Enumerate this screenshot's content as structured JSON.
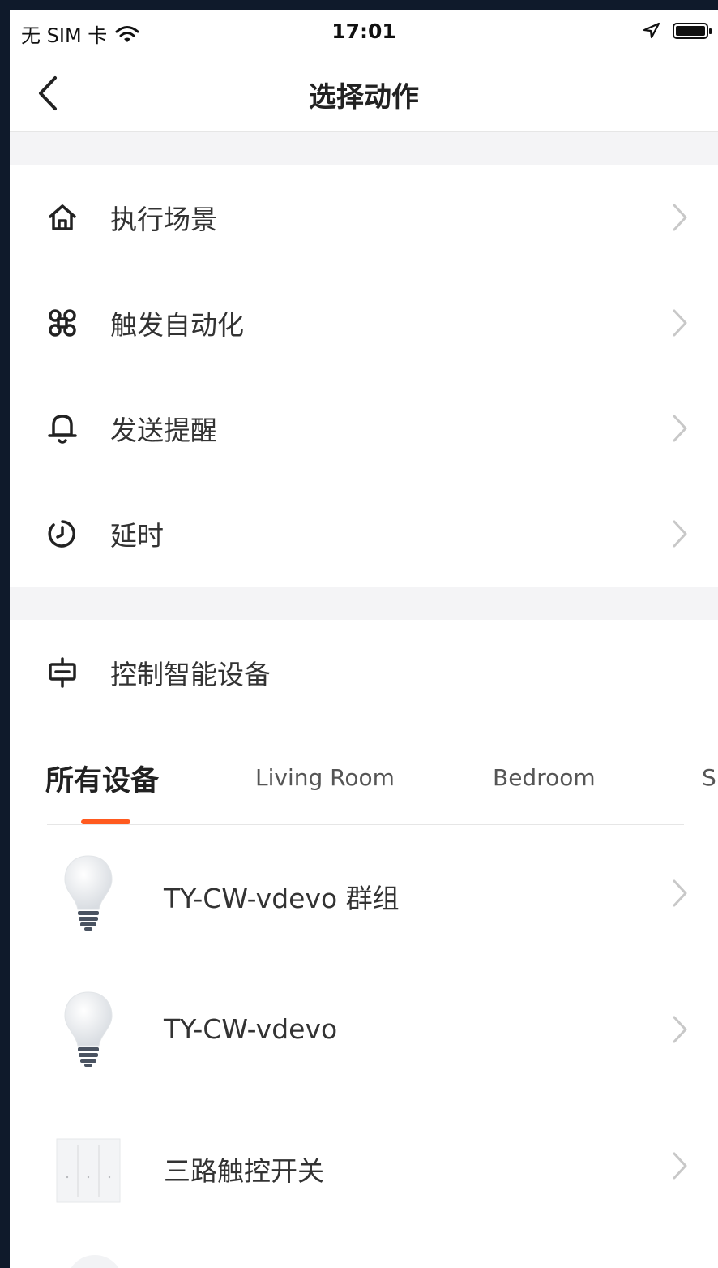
{
  "status_bar": {
    "carrier": "无 SIM 卡",
    "time": "17:01"
  },
  "header": {
    "title": "选择动作"
  },
  "actions": [
    {
      "label": "执行场景",
      "icon": "home-icon"
    },
    {
      "label": "触发自动化",
      "icon": "command-icon"
    },
    {
      "label": "发送提醒",
      "icon": "bell-icon"
    },
    {
      "label": "延时",
      "icon": "timer-icon"
    }
  ],
  "control_section": {
    "label": "控制智能设备",
    "icon": "device-control-icon"
  },
  "tabs": [
    {
      "label": "所有设备",
      "active": true
    },
    {
      "label": "Living Room"
    },
    {
      "label": "Bedroom"
    },
    {
      "label": "S"
    }
  ],
  "devices": [
    {
      "name": "TY-CW-vdevo 群组",
      "icon": "bulb-icon"
    },
    {
      "name": "TY-CW-vdevo",
      "icon": "bulb-icon"
    },
    {
      "name": "三路触控开关",
      "icon": "switch-panel-icon"
    }
  ],
  "colors": {
    "accent": "#ff5a1f",
    "background": "#ffffff",
    "divider_band": "#f4f4f6"
  }
}
